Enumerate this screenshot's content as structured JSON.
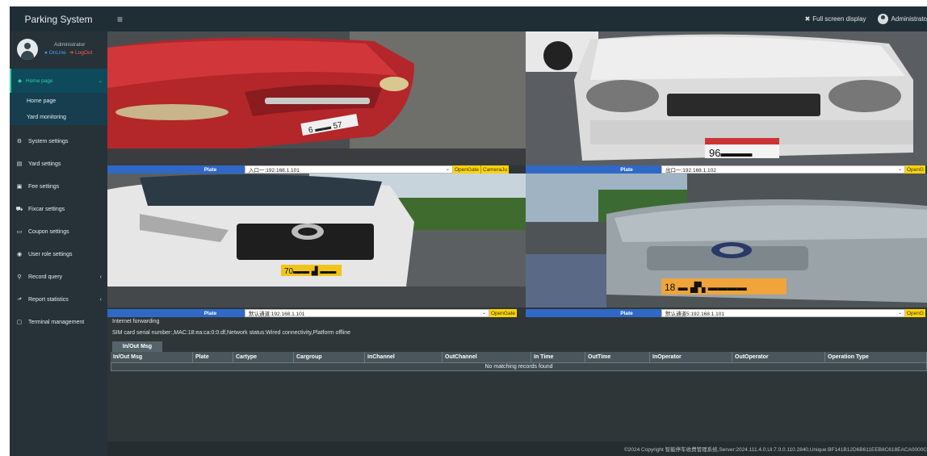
{
  "header": {
    "brand": "Parking System",
    "menu_toggle": "≡",
    "fullscreen_label": "Full screen display",
    "user_label": "Administrato"
  },
  "user": {
    "name": "Administrator",
    "online_label": "OnLine",
    "logout_label": "LogOut"
  },
  "sidebar": {
    "home": {
      "label": "Home page",
      "icon": "dashboard-icon"
    },
    "home_sub": [
      {
        "label": "Home page"
      },
      {
        "label": "Yard monitoring"
      }
    ],
    "items": [
      {
        "label": "System settings",
        "icon": "gears-icon",
        "glyph": "⚙"
      },
      {
        "label": "Yard settings",
        "icon": "file-icon",
        "glyph": "▤"
      },
      {
        "label": "Fee settings",
        "icon": "money-icon",
        "glyph": "▣"
      },
      {
        "label": "Fixcar settings",
        "icon": "car-icon",
        "glyph": "⛟"
      },
      {
        "label": "Coupon settings",
        "icon": "calendar-icon",
        "glyph": "▭"
      },
      {
        "label": "User role settings",
        "icon": "user-role-icon",
        "glyph": "◉"
      },
      {
        "label": "Record query",
        "icon": "search-icon",
        "glyph": "⚲",
        "arrow": "‹"
      },
      {
        "label": "Report statistics",
        "icon": "chart-icon",
        "glyph": "⬏",
        "arrow": "‹"
      },
      {
        "label": "Terminal management",
        "icon": "monitor-icon",
        "glyph": "▢"
      }
    ]
  },
  "cameras": [
    {
      "plate_label": "Plate",
      "channel": "入口一:192.168.1.101",
      "btn1": "OpenGate",
      "btn2": "CameraJu"
    },
    {
      "plate_label": "Plate",
      "channel": "出口一:192.168.1.102",
      "btn1": "OpenG"
    },
    {
      "plate_label": "Plate",
      "channel": "默认通道:192.168.1.101",
      "btn1": "OpenGate"
    },
    {
      "plate_label": "Plate",
      "channel": "默认通道5:192.168.1.101",
      "btn1": "OpenG"
    }
  ],
  "camera_plates": [
    "6 ▬▬ 57",
    "96▬▬▬",
    "70▬▬ ▟ ▬▬",
    "18 ▬ ▟▚ ▬▬▬▬"
  ],
  "info": {
    "forwarding": "Internet forwarding",
    "sim": "SIM card serial number:,MAC:18:ea:ca:0:0:df,Network status:Wired connectivity,Platform offline"
  },
  "tab": {
    "label": "In/Out Msg"
  },
  "table": {
    "columns": [
      "In/Out Msg",
      "Plate",
      "Cartype",
      "Cargroup",
      "InChannel",
      "OutChannel",
      "In Time",
      "OutTime",
      "InOperator",
      "OutOperator",
      "Operation Type"
    ],
    "empty_message": "No matching records found"
  },
  "footer": {
    "text": "©2024 Copyright 智能停车收费管理系统,Server:2024.111.4.0,Ui:7.0.0.110.2840,Unique:BF141B12D6B611EEB8C618EACA0000C"
  }
}
